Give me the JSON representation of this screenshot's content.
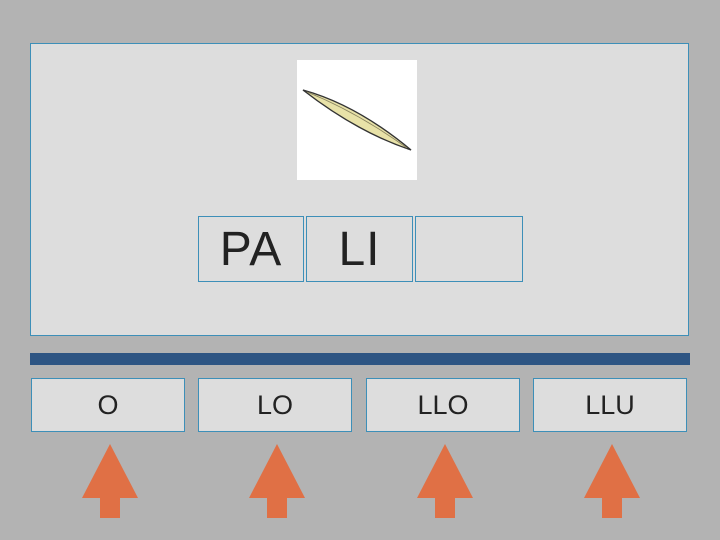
{
  "word": {
    "picture_icon": "needle-icon",
    "syllables": [
      "PA",
      "LI",
      ""
    ]
  },
  "options": [
    "O",
    "LO",
    "LLO",
    "LLU"
  ],
  "colors": {
    "background": "#b3b3b3",
    "panel": "#dddddd",
    "border": "#3d8fb8",
    "divider": "#2e5583",
    "arrow": "#e07045"
  }
}
